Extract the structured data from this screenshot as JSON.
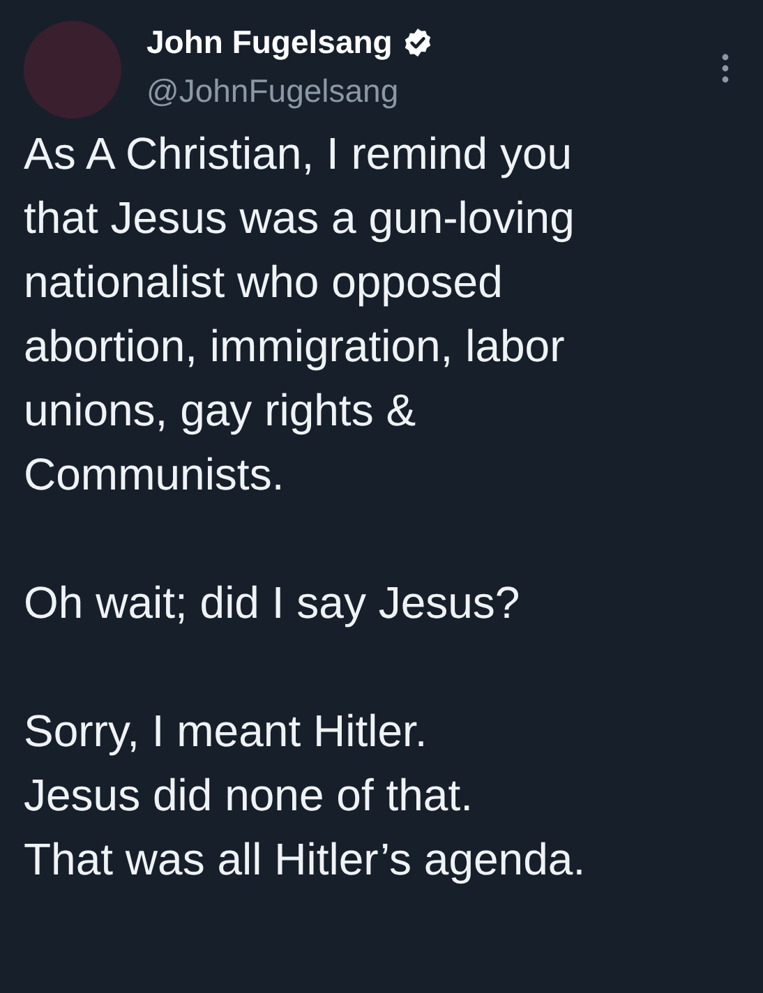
{
  "tweet": {
    "author": {
      "name": "John Fugelsang",
      "verified": true,
      "handle": "@JohnFugelsang"
    },
    "paragraphs": [
      "As A Christian, I remind you\nthat Jesus was a gun-loving\nnationalist who opposed\nabortion, immigration, labor\nunions, gay rights &\nCommunists.",
      "Oh wait; did I say Jesus?",
      "Sorry, I meant Hitler.\nJesus did none of that.\nThat was all Hitler’s agenda."
    ]
  }
}
